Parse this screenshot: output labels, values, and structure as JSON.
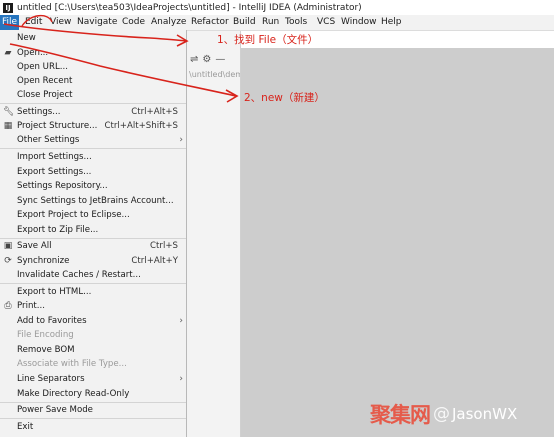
{
  "window": {
    "title": "untitled [C:\\Users\\tea503\\IdeaProjects\\untitled] - IntelliJ IDEA (Administrator)"
  },
  "menubar": {
    "items": [
      "File",
      "Edit",
      "View",
      "Navigate",
      "Code",
      "Analyze",
      "Refactor",
      "Build",
      "Run",
      "Tools",
      "VCS",
      "Window",
      "Help"
    ]
  },
  "file_menu": {
    "items": [
      {
        "label": "New",
        "icon": "",
        "shortcut": "",
        "submenu": false,
        "disabled": false
      },
      {
        "label": "Open...",
        "icon": "folder-icon",
        "shortcut": "",
        "submenu": false,
        "disabled": false
      },
      {
        "label": "Open URL...",
        "icon": "",
        "shortcut": "",
        "submenu": false,
        "disabled": false
      },
      {
        "label": "Open Recent",
        "icon": "",
        "shortcut": "",
        "submenu": false,
        "disabled": false
      },
      {
        "label": "Close Project",
        "icon": "",
        "shortcut": "",
        "submenu": false,
        "disabled": false
      },
      {
        "label": "Settings...",
        "icon": "wrench-icon",
        "shortcut": "Ctrl+Alt+S",
        "submenu": false,
        "disabled": false
      },
      {
        "label": "Project Structure...",
        "icon": "project-structure-icon",
        "shortcut": "Ctrl+Alt+Shift+S",
        "submenu": false,
        "disabled": false
      },
      {
        "label": "Other Settings",
        "icon": "",
        "shortcut": "",
        "submenu": true,
        "disabled": false
      },
      {
        "label": "Import Settings...",
        "icon": "",
        "shortcut": "",
        "submenu": false,
        "disabled": false
      },
      {
        "label": "Export Settings...",
        "icon": "",
        "shortcut": "",
        "submenu": false,
        "disabled": false
      },
      {
        "label": "Settings Repository...",
        "icon": "",
        "shortcut": "",
        "submenu": false,
        "disabled": false
      },
      {
        "label": "Sync Settings to JetBrains Account...",
        "icon": "",
        "shortcut": "",
        "submenu": false,
        "disabled": false
      },
      {
        "label": "Export Project to Eclipse...",
        "icon": "",
        "shortcut": "",
        "submenu": false,
        "disabled": false
      },
      {
        "label": "Export to Zip File...",
        "icon": "",
        "shortcut": "",
        "submenu": false,
        "disabled": false
      },
      {
        "label": "Save All",
        "icon": "save-icon",
        "shortcut": "Ctrl+S",
        "submenu": false,
        "disabled": false
      },
      {
        "label": "Synchronize",
        "icon": "sync-icon",
        "shortcut": "Ctrl+Alt+Y",
        "submenu": false,
        "disabled": false
      },
      {
        "label": "Invalidate Caches / Restart...",
        "icon": "",
        "shortcut": "",
        "submenu": false,
        "disabled": false
      },
      {
        "label": "Export to HTML...",
        "icon": "",
        "shortcut": "",
        "submenu": false,
        "disabled": false
      },
      {
        "label": "Print...",
        "icon": "printer-icon",
        "shortcut": "",
        "submenu": false,
        "disabled": false
      },
      {
        "label": "Add to Favorites",
        "icon": "",
        "shortcut": "",
        "submenu": true,
        "disabled": false
      },
      {
        "label": "File Encoding",
        "icon": "",
        "shortcut": "",
        "submenu": false,
        "disabled": true
      },
      {
        "label": "Remove BOM",
        "icon": "",
        "shortcut": "",
        "submenu": false,
        "disabled": false
      },
      {
        "label": "Associate with File Type...",
        "icon": "",
        "shortcut": "",
        "submenu": false,
        "disabled": true
      },
      {
        "label": "Line Separators",
        "icon": "",
        "shortcut": "",
        "submenu": true,
        "disabled": false
      },
      {
        "label": "Make Directory Read-Only",
        "icon": "",
        "shortcut": "",
        "submenu": false,
        "disabled": false
      },
      {
        "label": "Power Save Mode",
        "icon": "",
        "shortcut": "",
        "submenu": false,
        "disabled": false
      },
      {
        "label": "Exit",
        "icon": "",
        "shortcut": "",
        "submenu": false,
        "disabled": false
      }
    ]
  },
  "editor": {
    "path_hint": "\\untitled\\dem"
  },
  "annotations": {
    "note1": "1、找到 File（文件）",
    "note2": "2、new（新建）",
    "color": "#d8231b"
  },
  "watermark": {
    "logo": "聚集网",
    "at": "@",
    "handle": "JasonWX"
  }
}
